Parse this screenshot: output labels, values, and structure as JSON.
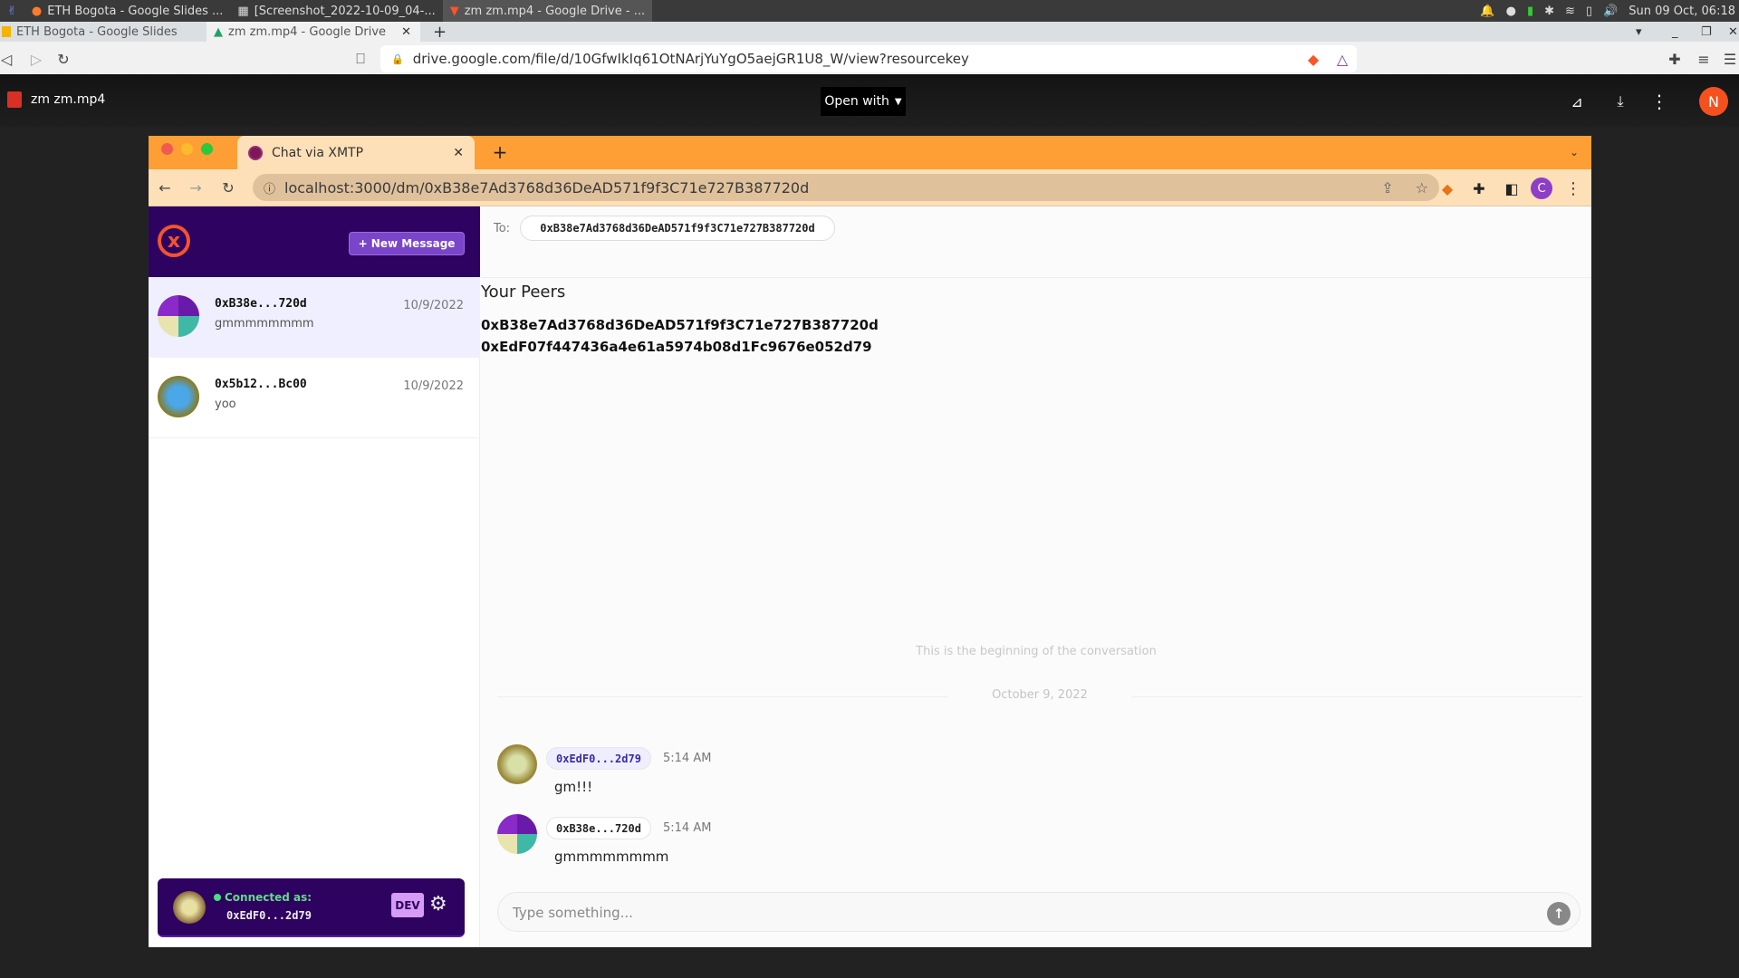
{
  "os": {
    "tasks": [
      {
        "label": "ETH Bogota - Google Slides ...",
        "icon": "firefox-icon"
      },
      {
        "label": "[Screenshot_2022-10-09_04-...",
        "icon": "image-viewer-icon"
      },
      {
        "label": "zm zm.mp4 - Google Drive - ...",
        "icon": "brave-icon"
      }
    ],
    "clock": "Sun 09 Oct, 06:18"
  },
  "browser": {
    "tabs": [
      {
        "label": "ETH Bogota - Google Slides"
      },
      {
        "label": "zm zm.mp4 - Google Drive"
      }
    ],
    "url": "drive.google.com/file/d/10GfwIkIq61OtNArjYuYgO5aejGR1U8_W/view?resourcekey"
  },
  "drive": {
    "file_name": "zm zm.mp4",
    "open_with": "Open with",
    "avatar_letter": "N"
  },
  "inner_browser": {
    "tab_title": "Chat via XMTP",
    "url": "localhost:3000/dm/0xB38e7Ad3768d36DeAD571f9f3C71e727B387720d",
    "profile_letter": "C"
  },
  "app": {
    "new_message": "+ New Message",
    "conversations": [
      {
        "address": "0xB38e...720d",
        "preview": "gmmmmmmmm",
        "date": "10/9/2022",
        "selected": true
      },
      {
        "address": "0x5b12...Bc00",
        "preview": "yoo",
        "date": "10/9/2022",
        "selected": false
      }
    ],
    "connected": {
      "label": "Connected as:",
      "address": "0xEdF0...2d79",
      "env": "DEV"
    },
    "to_label": "To:",
    "to_address": "0xB38e7Ad3768d36DeAD571f9f3C71e727B387720d",
    "peers_title": "Your Peers",
    "peers": [
      "0xB38e7Ad3768d36DeAD571f9f3C71e727B387720d",
      "0xEdF07f447436a4e61a5974b08d1Fc9676e052d79"
    ],
    "beginning": "This is the beginning of the conversation",
    "date_divider": "October 9, 2022",
    "messages": [
      {
        "sender": "0xEdF0...2d79",
        "time": "5:14 AM",
        "text": "gm!!!",
        "self": true
      },
      {
        "sender": "0xB38e...720d",
        "time": "5:14 AM",
        "text": "gmmmmmmmm",
        "self": false
      }
    ],
    "composer_placeholder": "Type something..."
  }
}
